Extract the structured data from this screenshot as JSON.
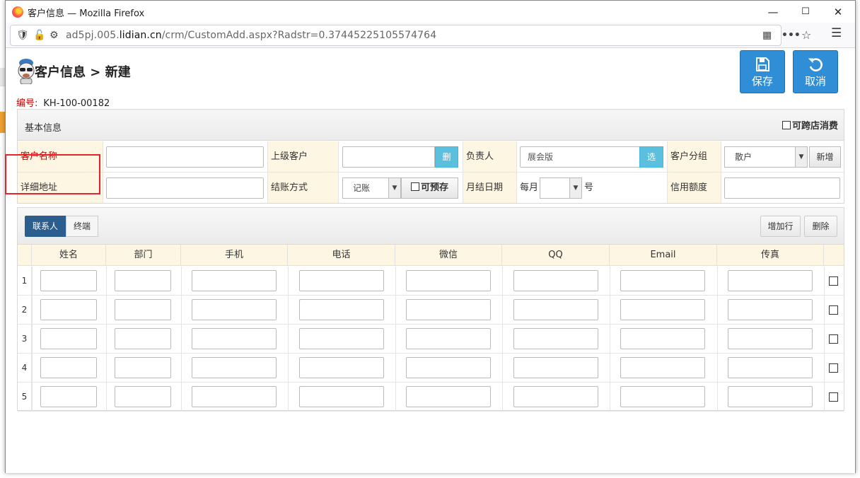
{
  "window": {
    "title": "客户信息 — Mozilla Firefox",
    "minimize": "—",
    "maximize": "☐",
    "close": "✕"
  },
  "nav": {
    "url_prefix": "ad5pj.005.",
    "url_domain": "lidian.cn",
    "url_path": "/crm/CustomAdd.aspx?Radstr=0.37445225105574764"
  },
  "page": {
    "title": "客户信息 > 新建",
    "save_label": "保存",
    "cancel_label": "取消",
    "code_label": "编号:",
    "code_value": "KH-100-00182"
  },
  "basic": {
    "title": "基本信息",
    "cross_store": "可跨店消费",
    "row1": {
      "name_label": "客户名称",
      "parent_label": "上级客户",
      "parent_btn": "删",
      "owner_label": "负责人",
      "owner_value": "展会版",
      "owner_btn": "选",
      "group_label": "客户分组",
      "group_value": "散户",
      "group_add": "新增"
    },
    "row2": {
      "address_label": "详细地址",
      "settle_label": "结账方式",
      "settle_value": "记账",
      "prepay_label": "可预存",
      "monthly_label": "月结日期",
      "month_prefix": "每月",
      "month_suffix": "号",
      "credit_label": "信用额度"
    }
  },
  "contacts": {
    "tabs": [
      "联系人",
      "终端"
    ],
    "add_row": "增加行",
    "delete": "删除",
    "columns": [
      "姓名",
      "部门",
      "手机",
      "电话",
      "微信",
      "QQ",
      "Email",
      "传真"
    ],
    "rows": [
      "1",
      "2",
      "3",
      "4",
      "5"
    ]
  },
  "colors": {
    "accent": "#2f8ed5",
    "tab_active": "#2c5d8f",
    "label_bg": "#fdf6e3",
    "required": "#cc0000",
    "highlight": "#e5252b"
  }
}
